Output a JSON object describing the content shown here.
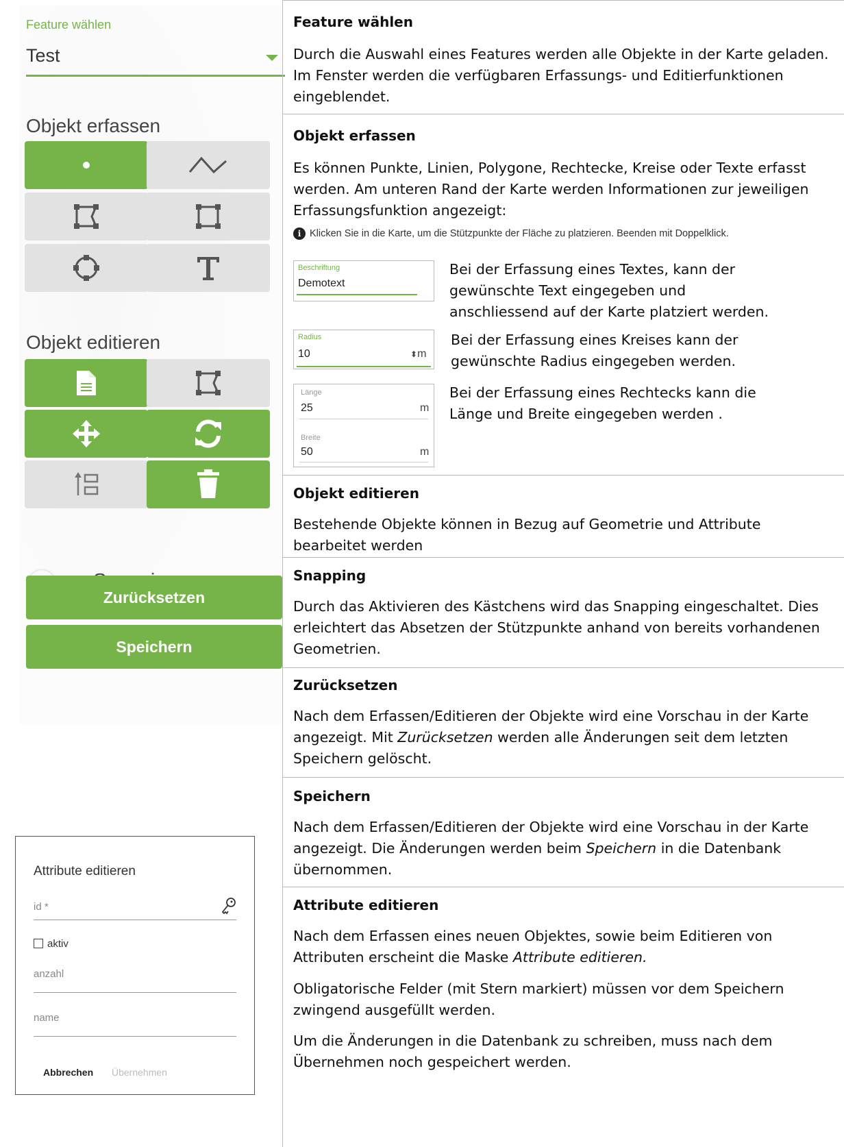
{
  "left_panel": {
    "feature_label": "Feature wählen",
    "feature_value": "Test",
    "capture_heading": "Objekt erfassen",
    "capture_tools": [
      {
        "name": "point-icon",
        "active": true
      },
      {
        "name": "line-icon",
        "active": false
      },
      {
        "name": "polygon-icon",
        "active": false
      },
      {
        "name": "rectangle-icon",
        "active": false
      },
      {
        "name": "circle-icon",
        "active": false
      },
      {
        "name": "text-icon",
        "active": false
      }
    ],
    "edit_heading": "Objekt editieren",
    "edit_tools": [
      {
        "name": "attributes-document-icon",
        "active": true
      },
      {
        "name": "edit-geometry-icon",
        "active": false
      },
      {
        "name": "move-icon",
        "active": true
      },
      {
        "name": "rotate-icon",
        "active": true
      },
      {
        "name": "reorder-icon",
        "active": false
      },
      {
        "name": "trash-icon",
        "active": true
      }
    ],
    "snapping_label": "Snapping",
    "snapping_on": false,
    "reset_label": "Zurücksetzen",
    "save_label": "Speichern",
    "accent_color": "#76b44a"
  },
  "dialog": {
    "title": "Attribute editieren",
    "field_id": "id *",
    "checkbox_label": "aktiv",
    "field_anzahl": "anzahl",
    "field_name": "name",
    "cancel_label": "Abbrechen",
    "ok_label": "Übernehmen"
  },
  "right": {
    "s1_head": "Feature wählen",
    "s1_text": "Durch die Auswahl eines Features werden alle Objekte in der Karte geladen. Im Fenster werden die verfügbaren Erfassungs- und Editierfunktionen eingeblendet.",
    "s2_head": "Objekt erfassen",
    "s2_text": "Es können Punkte, Linien, Polygone, Rechtecke, Kreise oder Texte erfasst werden. Am unteren Rand der Karte werden Informationen zur jeweiligen Erfassungsfunktion angezeigt:",
    "s2_info": "Klicken Sie in die Karte, um die Stützpunkte der Fläche zu platzieren. Beenden mit Doppelklick.",
    "label_box": {
      "label": "Beschriftung",
      "value": "Demotext"
    },
    "label_desc": "Bei der Erfassung eines Textes, kann der gewünschte Text eingegeben und anschliessend auf der Karte platziert werden.",
    "radius_box": {
      "label": "Radius",
      "value": "10",
      "unit": "m"
    },
    "radius_desc": "Bei der Erfassung eines Kreises kann der gewünschte Radius eingegeben werden.",
    "rect_box": {
      "len_label": "Länge",
      "len_value": "25",
      "wid_label": "Breite",
      "wid_value": "50",
      "unit": "m"
    },
    "rect_desc": "Bei der Erfassung eines Rechtecks kann die Länge und Breite eingegeben werden .",
    "s3_head": "Objekt editieren",
    "s3_text": "Bestehende Objekte können in Bezug auf Geometrie und Attribute bearbeitet werden",
    "s4_head": "Snapping",
    "s4_text": "Durch das Aktivieren des Kästchens wird das Snapping eingeschaltet. Dies erleichtert das Absetzen der Stützpunkte anhand von bereits vorhandenen Geometrien.",
    "s5_head": "Zurücksetzen",
    "s5_text_a": "Nach dem Erfassen/Editieren der Objekte wird eine Vorschau in der Karte angezeigt. Mit ",
    "s5_text_em": "Zurücksetzen",
    "s5_text_b": " werden alle Änderungen seit dem letzten Speichern gelöscht.",
    "s6_head": "Speichern",
    "s6_text_a": "Nach dem Erfassen/Editieren der Objekte wird eine Vorschau in der Karte angezeigt. Die Änderungen werden beim ",
    "s6_text_em": "Speichern",
    "s6_text_b": " in die Datenbank übernommen.",
    "s7_head": "Attribute editieren",
    "s7_text_a": "Nach dem Erfassen eines neuen Objektes, sowie beim Editieren von Attributen erscheint die Maske ",
    "s7_text_em": "Attribute editieren.",
    "s7_text_2": "Obligatorische Felder (mit Stern markiert) müssen vor dem Speichern zwingend ausgefüllt werden.",
    "s7_text_3": "Um die Änderungen in die Datenbank zu schreiben, muss nach dem Übernehmen noch gespeichert werden."
  }
}
